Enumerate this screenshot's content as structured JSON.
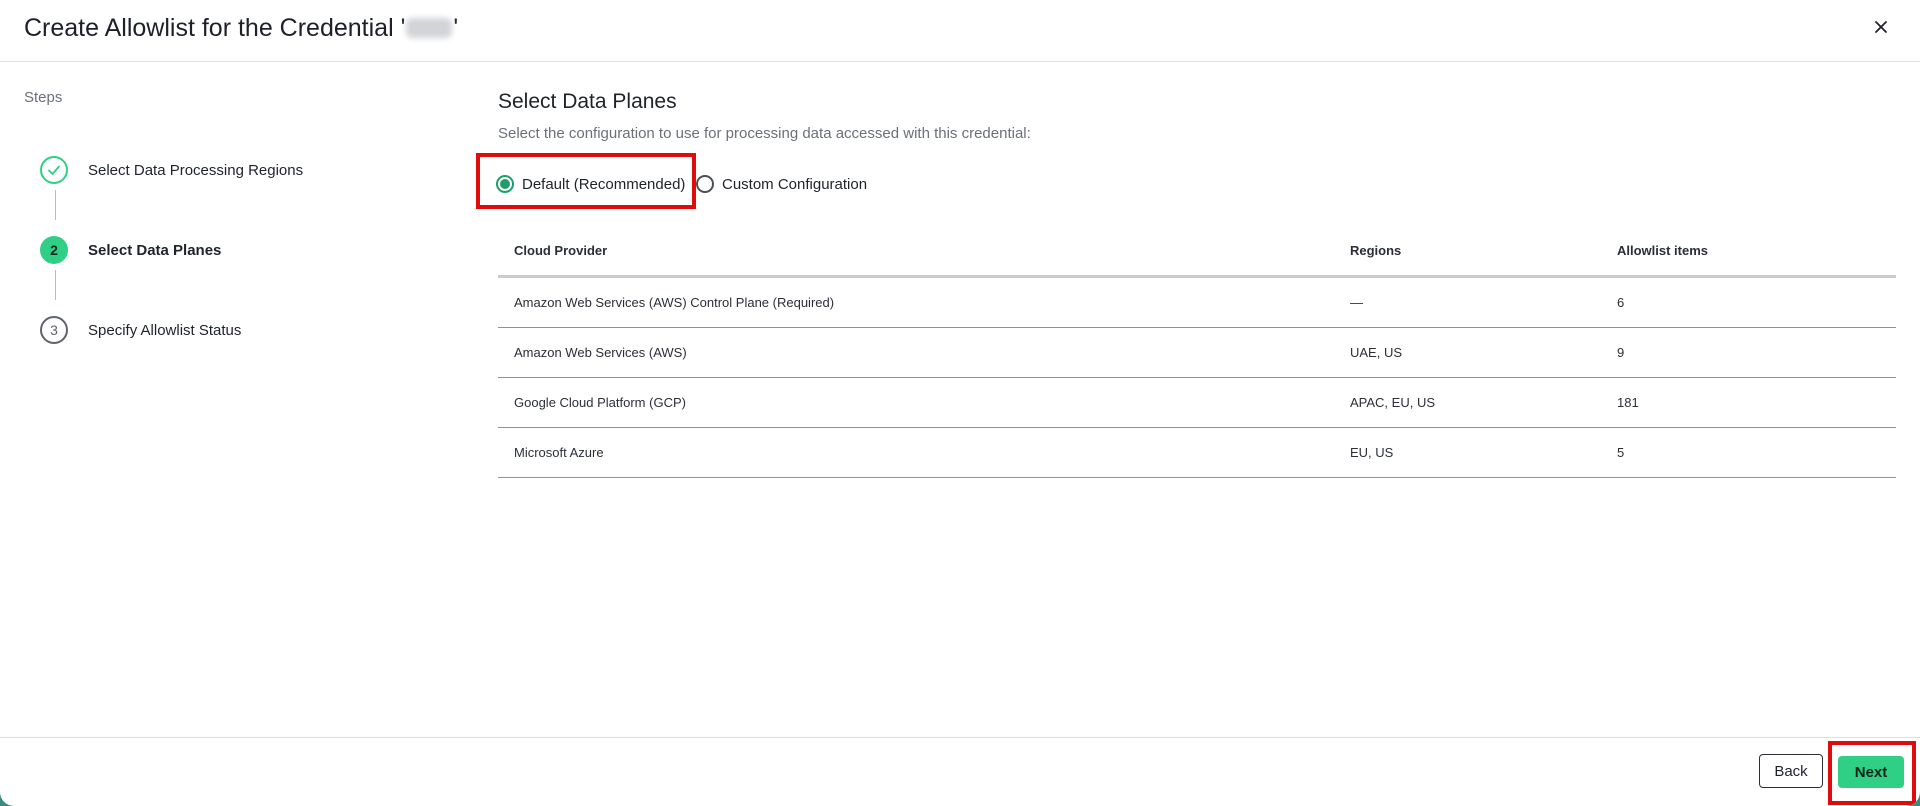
{
  "header": {
    "title_prefix": "Create Allowlist for the Credential '",
    "title_suffix": "'",
    "close_icon": "close-icon"
  },
  "steps": {
    "heading": "Steps",
    "items": [
      {
        "number": "",
        "label": "Select Data Processing Regions",
        "state": "completed",
        "icon": "check-icon"
      },
      {
        "number": "2",
        "label": "Select Data Planes",
        "state": "active"
      },
      {
        "number": "3",
        "label": "Specify Allowlist Status",
        "state": "pending"
      }
    ]
  },
  "main": {
    "title": "Select Data Planes",
    "description": "Select the configuration to use for processing data accessed with this credential:",
    "options": [
      {
        "label": "Default (Recommended)",
        "selected": true
      },
      {
        "label": "Custom Configuration",
        "selected": false
      }
    ],
    "table": {
      "columns": [
        "Cloud Provider",
        "Regions",
        "Allowlist items"
      ],
      "rows": [
        [
          "Amazon Web Services (AWS) Control Plane (Required)",
          "—",
          "6"
        ],
        [
          "Amazon Web Services (AWS)",
          "UAE, US",
          "9"
        ],
        [
          "Google Cloud Platform (GCP)",
          "APAC, EU, US",
          "181"
        ],
        [
          "Microsoft Azure",
          "EU, US",
          "5"
        ]
      ]
    }
  },
  "footer": {
    "back_label": "Back",
    "next_label": "Next"
  },
  "colors": {
    "accent": "#2fcf86",
    "radio_selected": "#1d9e68",
    "highlight": "#e00c0c"
  }
}
